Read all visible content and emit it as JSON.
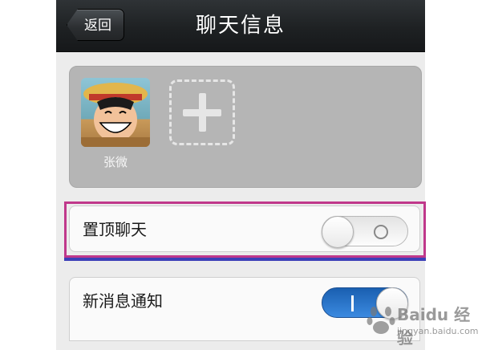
{
  "navbar": {
    "back_label": "返回",
    "title": "聊天信息"
  },
  "members": [
    {
      "name": "张微",
      "avatar_icon": "anime-avatar-icon"
    }
  ],
  "add_member_icon": "plus-icon",
  "settings": [
    {
      "label": "置顶聊天",
      "toggle_on": false
    },
    {
      "label": "新消息通知",
      "toggle_on": true
    }
  ],
  "highlight_colors": {
    "frame": "#c0388b",
    "underline": "#3c40b8"
  },
  "accent_color": "#2a77d0",
  "watermark": {
    "text": "Baidu 经验",
    "sub": "jingyan.baidu.com"
  }
}
